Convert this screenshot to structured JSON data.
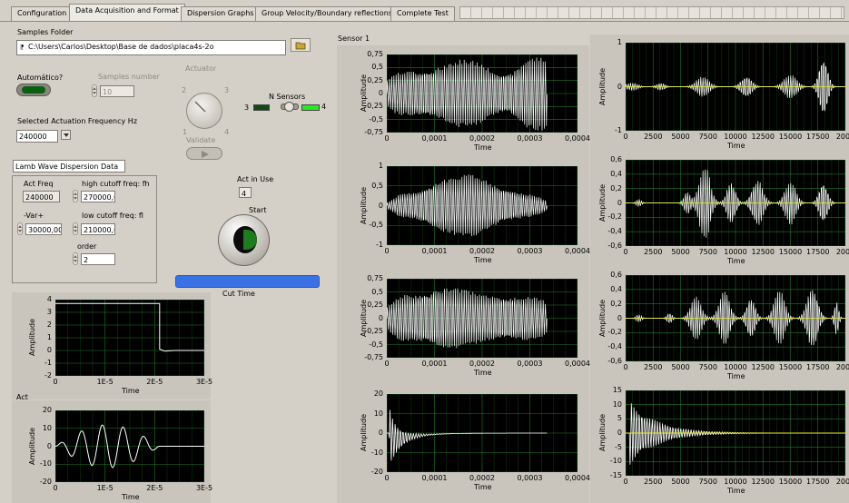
{
  "tabs": [
    {
      "label": "Configuration",
      "active": false
    },
    {
      "label": "Data Acquisition and Format",
      "active": true
    },
    {
      "label": "Dispersion Graphs",
      "active": false
    },
    {
      "label": "Group Velocity/Boundary reflections",
      "active": false
    },
    {
      "label": "Complete Test",
      "active": false
    }
  ],
  "samples_folder": {
    "label": "Samples Folder",
    "path": "C:\\Users\\Carlos\\Desktop\\Base de dados\\placa4s-2o"
  },
  "automatico": {
    "label": "Automático?"
  },
  "samples_number": {
    "label": "Samples number",
    "value": "10"
  },
  "actuator": {
    "label": "Actuator",
    "knob_labels": [
      "1",
      "2",
      "3",
      "4"
    ],
    "validate_label": "Validate"
  },
  "n_sensors": {
    "label": "N Sensors",
    "low": "3",
    "high": "4"
  },
  "actuation_frequency": {
    "label": "Selected Actuation Frequency Hz",
    "value": "240000"
  },
  "lamb_wave": {
    "title": "Lamb Wave Dispersion Data",
    "act_freq_label": "Act Freq",
    "act_freq_value": "240000",
    "var_label": "-Var+",
    "var_value": "30000,00",
    "high_cutoff_label": "high cutoff freq: fh",
    "high_cutoff_value": "270000,0",
    "low_cutoff_label": "low cutoff freq: fl",
    "low_cutoff_value": "210000,0",
    "order_label": "order",
    "order_value": "2"
  },
  "act_in_use": {
    "label": "Act in Use",
    "value": "4"
  },
  "start": {
    "label": "Start"
  },
  "cut_time": {
    "label": "Cut Time"
  },
  "sensor_label": "Sensor 1",
  "act_label": "Act",
  "colors": {
    "window": "#d4d0c8",
    "plot_bg": "#000000",
    "grid": "#1f7a2a",
    "trace": "#ffffff",
    "trace_yellow": "#f0f020",
    "progress": "#3a72e6",
    "led_green": "#28e628"
  },
  "chart_data": [
    {
      "id": "cut",
      "type": "line",
      "xlabel": "Time",
      "ylabel": "Amplitude",
      "x_ticks": [
        "0",
        "1E-5",
        "2E-5",
        "3E-5"
      ],
      "y_ticks": [
        "4",
        "3",
        "2",
        "1",
        "0",
        "-1",
        "-2"
      ],
      "xlim": [
        0,
        3e-05
      ],
      "ylim": [
        -2,
        4
      ],
      "series": [
        {
          "x": [
            0,
            2.1e-05,
            2.1e-05,
            2.2e-05,
            2.4e-05,
            3e-05
          ],
          "y": [
            3.7,
            3.7,
            0.1,
            -0.05,
            0.0,
            0.0
          ]
        }
      ]
    },
    {
      "id": "act",
      "type": "line",
      "xlabel": "Time",
      "ylabel": "Amplitude",
      "x_ticks": [
        "0",
        "1E-5",
        "2E-5",
        "3E-5"
      ],
      "y_ticks": [
        "20",
        "10",
        "0",
        "-10",
        "-20"
      ],
      "xlim": [
        0,
        3e-05
      ],
      "ylim": [
        -20,
        20
      ],
      "description": "5-cycle tone burst, peak ~12, ends ~2.1E-5"
    },
    {
      "id": "s1",
      "type": "line",
      "xlabel": "Time",
      "ylabel": "Amplitude",
      "x_ticks": [
        "0",
        "0,0001",
        "0,0002",
        "0,0003",
        "0,0004"
      ],
      "y_ticks": [
        "0,75",
        "0,5",
        "0,25",
        "0",
        "-0,25",
        "-0,5",
        "-0,75"
      ],
      "xlim": [
        0,
        0.0004
      ],
      "ylim": [
        -0.75,
        0.75
      ]
    },
    {
      "id": "s2",
      "type": "line",
      "xlabel": "Time",
      "ylabel": "Amplitude",
      "x_ticks": [
        "0",
        "0,0001",
        "0,0002",
        "0,0003",
        "0,0004"
      ],
      "y_ticks": [
        "1",
        "0,5",
        "0",
        "-0,5",
        "-1"
      ],
      "xlim": [
        0,
        0.0004
      ],
      "ylim": [
        -1,
        1
      ]
    },
    {
      "id": "s3",
      "type": "line",
      "xlabel": "Time",
      "ylabel": "Amplitude",
      "x_ticks": [
        "0",
        "0,0001",
        "0,0002",
        "0,0003",
        "0,0004"
      ],
      "y_ticks": [
        "0,75",
        "0,5",
        "0,25",
        "0",
        "-0,25",
        "-0,5",
        "-0,75"
      ],
      "xlim": [
        0,
        0.0004
      ],
      "ylim": [
        -0.75,
        0.75
      ]
    },
    {
      "id": "s4",
      "type": "line",
      "xlabel": "Time",
      "ylabel": "Amplitude",
      "x_ticks": [
        "0",
        "0,0001",
        "0,0002",
        "0,0003",
        "0,0004"
      ],
      "y_ticks": [
        "20",
        "10",
        "0",
        "-10",
        "-20"
      ],
      "xlim": [
        0,
        0.0004
      ],
      "ylim": [
        -20,
        20
      ]
    },
    {
      "id": "r1",
      "type": "line",
      "xlabel": "Time",
      "ylabel": "Amplitude",
      "x_ticks": [
        "0",
        "2500",
        "5000",
        "7500",
        "10000",
        "12500",
        "15000",
        "17500",
        "2000"
      ],
      "y_ticks": [
        "1",
        "0",
        "-1"
      ],
      "ylim": [
        -1,
        1
      ]
    },
    {
      "id": "r2",
      "type": "line",
      "xlabel": "Time",
      "ylabel": "Amplitude",
      "x_ticks": [
        "0",
        "2500",
        "5000",
        "7500",
        "10000",
        "12500",
        "15000",
        "17500",
        "2000"
      ],
      "y_ticks": [
        "0,6",
        "0,4",
        "0,2",
        "0",
        "-0,2",
        "-0,4",
        "-0,6"
      ],
      "ylim": [
        -0.6,
        0.6
      ]
    },
    {
      "id": "r3",
      "type": "line",
      "xlabel": "Time",
      "ylabel": "Amplitude",
      "x_ticks": [
        "0",
        "2500",
        "5000",
        "7500",
        "10000",
        "12500",
        "15000",
        "17500",
        "2000"
      ],
      "y_ticks": [
        "0,6",
        "0,4",
        "0,2",
        "0",
        "-0,2",
        "-0,4",
        "-0,6"
      ],
      "ylim": [
        -0.6,
        0.6
      ]
    },
    {
      "id": "r4",
      "type": "line",
      "xlabel": "Time",
      "ylabel": "Amplitude",
      "x_ticks": [
        "0",
        "2500",
        "5000",
        "7500",
        "10000",
        "12500",
        "15000",
        "17500",
        "2000"
      ],
      "y_ticks": [
        "15",
        "10",
        "5",
        "0",
        "-5",
        "-10",
        "-15"
      ],
      "ylim": [
        -15,
        15
      ]
    }
  ]
}
